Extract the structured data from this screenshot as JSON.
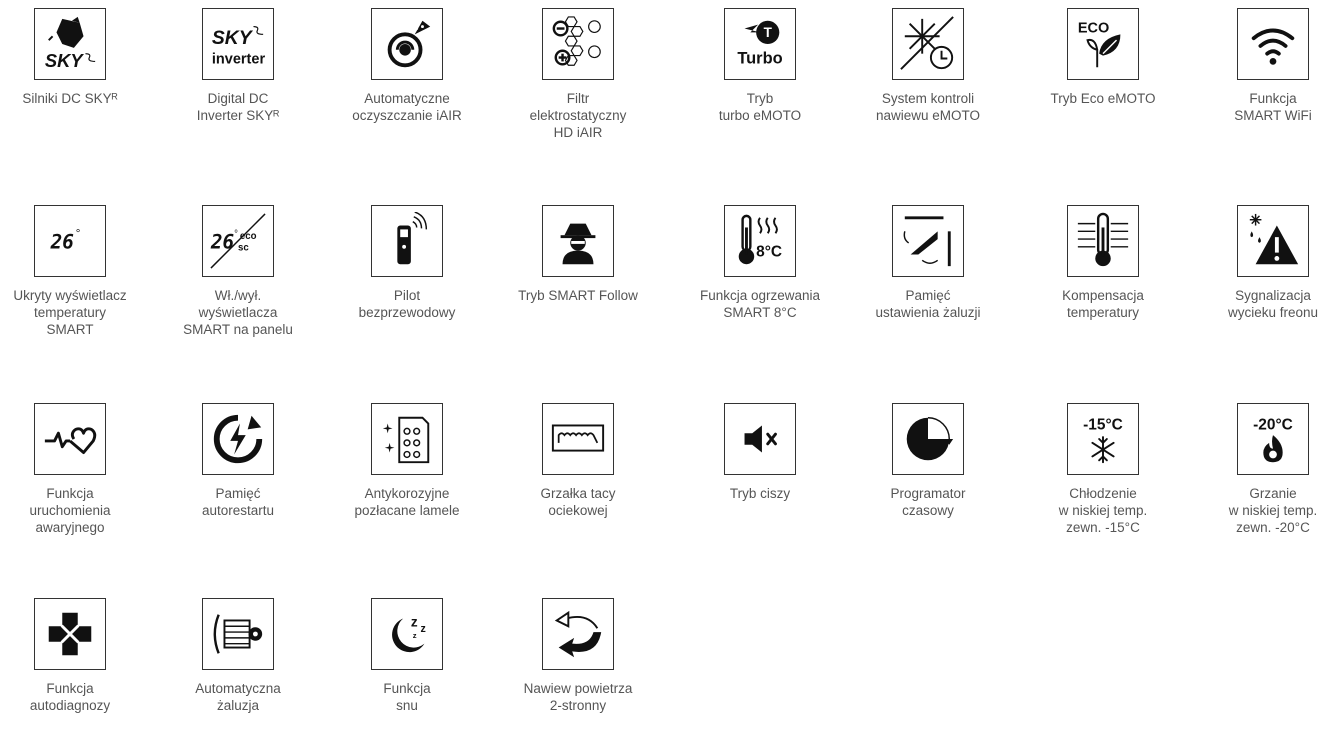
{
  "features": [
    {
      "icon": "sky-dc-motor-icon",
      "caption": [
        "Silniki DC SKYᴿ"
      ],
      "logo_text": "SKY"
    },
    {
      "icon": "sky-inverter-icon",
      "caption": [
        "Digital DC",
        "Inverter SKYᴿ"
      ],
      "logo_text": "SKY",
      "logo_sub": "inverter"
    },
    {
      "icon": "iair-auto-clean-icon",
      "caption": [
        "Automatyczne",
        "oczyszczanie iAIR"
      ]
    },
    {
      "icon": "electrostatic-filter-icon",
      "caption": [
        "Filtr",
        "elektrostatyczny",
        "HD iAIR"
      ]
    },
    {
      "icon": "turbo-mode-icon",
      "caption": [
        "Tryb",
        "turbo eMOTO"
      ],
      "badge": "T",
      "label": "Turbo"
    },
    {
      "icon": "airflow-control-icon",
      "caption": [
        "System kontroli",
        "nawiewu eMOTO"
      ]
    },
    {
      "icon": "eco-leaf-icon",
      "caption": [
        "Tryb Eco eMOTO"
      ],
      "label": "ECO"
    },
    {
      "icon": "wifi-icon",
      "caption": [
        "Funkcja",
        "SMART WiFi"
      ]
    },
    {
      "icon": "hidden-display-icon",
      "caption": [
        "Ukryty wyświetlacz",
        "temperatury",
        "SMART"
      ],
      "value": "26",
      "unit": "°"
    },
    {
      "icon": "display-toggle-icon",
      "caption": [
        "Wł./wył.",
        "wyświetlacza",
        "SMART na panelu"
      ],
      "value": "26",
      "unit": "°",
      "tag1": "eco",
      "tag2": "sc"
    },
    {
      "icon": "remote-control-icon",
      "caption": [
        "Pilot",
        "bezprzewodowy"
      ]
    },
    {
      "icon": "smart-follow-icon",
      "caption": [
        "Tryb SMART Follow"
      ]
    },
    {
      "icon": "heating-8c-icon",
      "caption": [
        "Funkcja ogrzewania",
        "SMART 8°C"
      ],
      "label": "8°C"
    },
    {
      "icon": "louver-memory-icon",
      "caption": [
        "Pamięć",
        "ustawienia żaluzji"
      ]
    },
    {
      "icon": "thermometer-compensation-icon",
      "caption": [
        "Kompensacja",
        "temperatury"
      ]
    },
    {
      "icon": "freon-leak-warning-icon",
      "caption": [
        "Sygnalizacja",
        "wycieku freonu"
      ]
    },
    {
      "icon": "heartbeat-icon",
      "caption": [
        "Funkcja",
        "uruchomienia",
        "awaryjnego"
      ]
    },
    {
      "icon": "auto-restart-icon",
      "caption": [
        "Pamięć",
        "autorestartu"
      ]
    },
    {
      "icon": "gold-fin-icon",
      "caption": [
        "Antykorozyjne",
        "pozłacane lamele"
      ]
    },
    {
      "icon": "drain-heater-icon",
      "caption": [
        "Grzałka tacy",
        "ociekowej"
      ]
    },
    {
      "icon": "mute-icon",
      "caption": [
        "Tryb ciszy"
      ]
    },
    {
      "icon": "timer-icon",
      "caption": [
        "Programator",
        "czasowy"
      ]
    },
    {
      "icon": "snowflake-low-temp-icon",
      "caption": [
        "Chłodzenie",
        "w niskiej temp.",
        "zewn. -15°C"
      ],
      "label": "-15°C"
    },
    {
      "icon": "flame-low-temp-icon",
      "caption": [
        "Grzanie",
        "w niskiej temp.",
        "zewn. -20°C"
      ],
      "label": "-20°C"
    },
    {
      "icon": "self-diagnosis-icon",
      "caption": [
        "Funkcja",
        "autodiagnozy"
      ]
    },
    {
      "icon": "auto-louver-icon",
      "caption": [
        "Automatyczna",
        "żaluzja"
      ]
    },
    {
      "icon": "sleep-moon-icon",
      "caption": [
        "Funkcja",
        "snu"
      ],
      "label": "z"
    },
    {
      "icon": "two-way-airflow-icon",
      "caption": [
        "Nawiew powietrza",
        "2-stronny"
      ]
    }
  ]
}
